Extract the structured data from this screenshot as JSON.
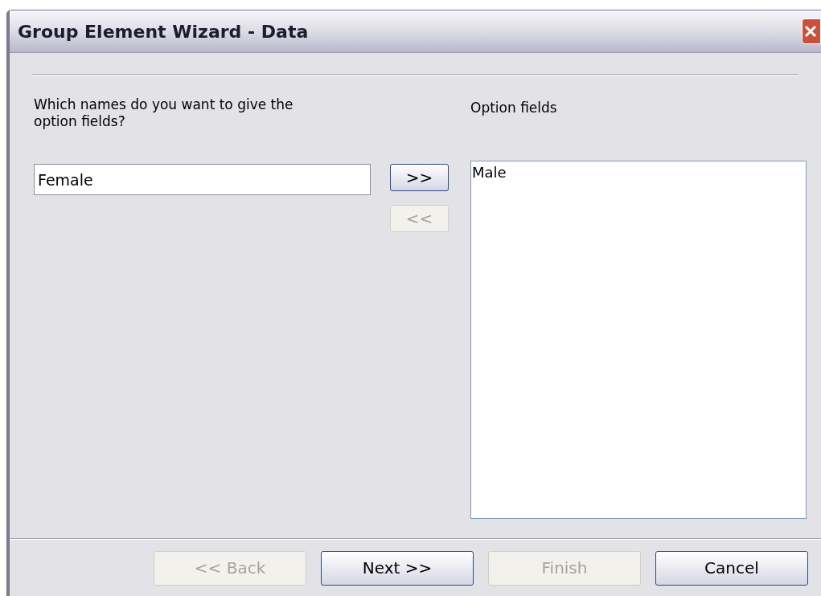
{
  "window": {
    "title": "Group Element Wizard - Data"
  },
  "names_label": "Which names do you want to give the option fields?",
  "name_field": {
    "value": "Female"
  },
  "move_buttons": [
    {
      "label": ">>",
      "disabled": false
    },
    {
      "label": "<<",
      "disabled": true
    }
  ],
  "option_fields": {
    "label": "Option fields",
    "items": [
      {
        "label": "Male",
        "selected": false
      }
    ]
  },
  "buttons": [
    {
      "label": "<< Back",
      "disabled": true
    },
    {
      "label": "Next >>",
      "disabled": false
    },
    {
      "label": "Finish",
      "disabled": true
    },
    {
      "label": "Cancel",
      "disabled": false
    }
  ]
}
